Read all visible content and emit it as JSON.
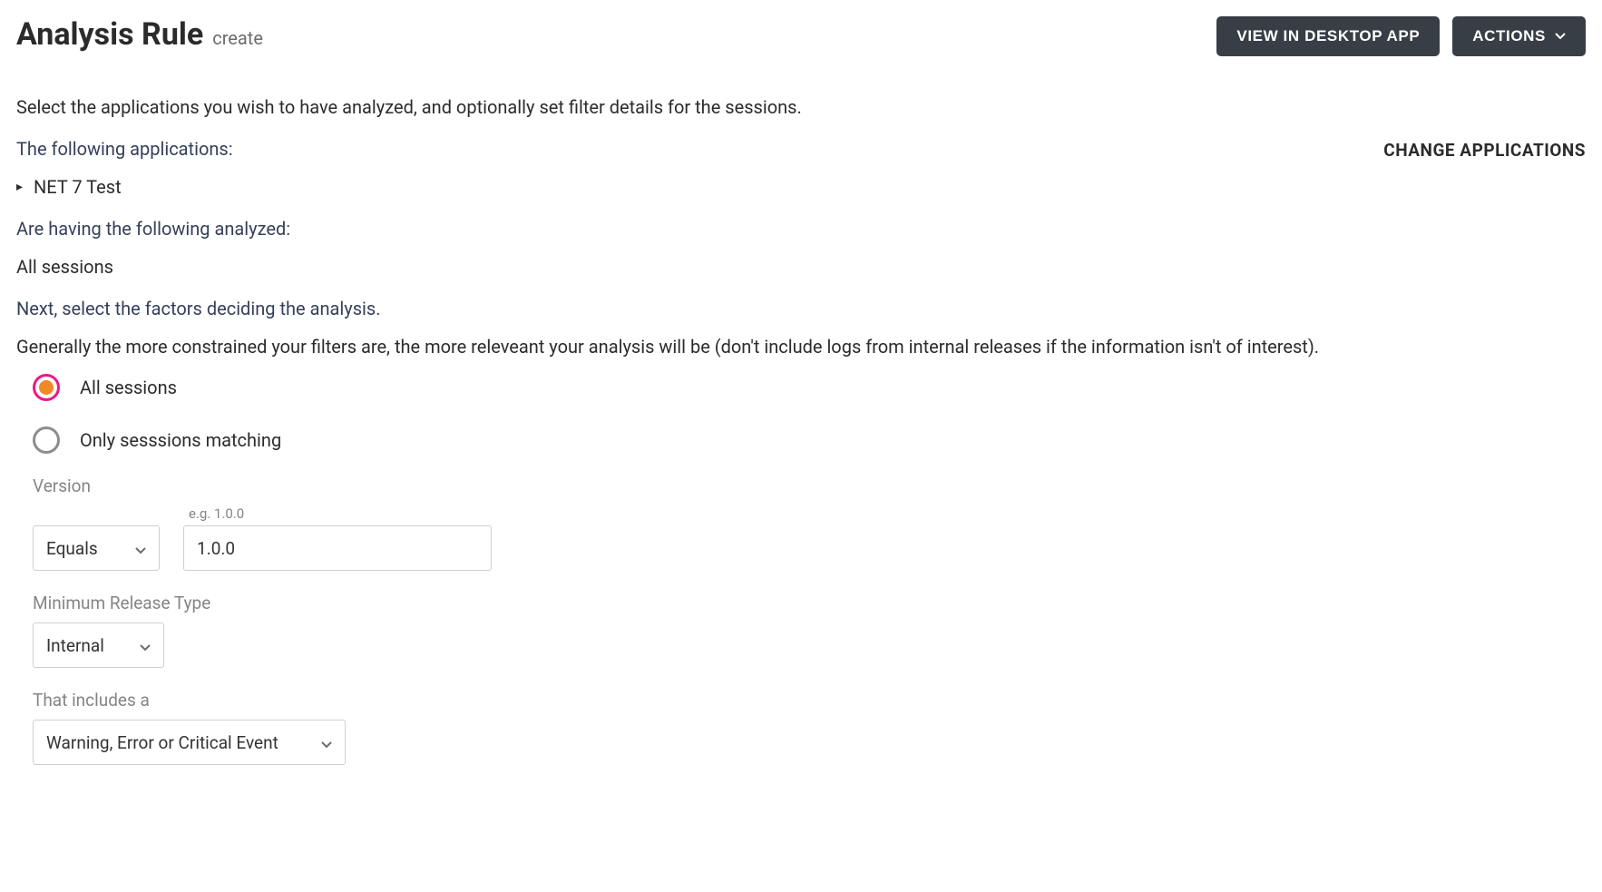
{
  "header": {
    "title": "Analysis Rule",
    "subtitle": "create",
    "view_button": "VIEW IN DESKTOP APP",
    "actions_button": "ACTIONS"
  },
  "intro": "Select the applications you wish to have analyzed, and optionally set filter details for the sessions.",
  "applications": {
    "heading": "The following applications:",
    "change_label": "CHANGE APPLICATIONS",
    "items": [
      "NET 7 Test"
    ]
  },
  "analyzed": {
    "heading": "Are having the following analyzed:",
    "value": "All sessions"
  },
  "factors_heading": "Next, select the factors deciding the analysis.",
  "factors_help": "Generally the more constrained your filters are, the more releveant your analysis will be (don't include logs from internal releases if the information isn't of interest).",
  "radio": {
    "all": "All sessions",
    "matching": "Only sesssions matching",
    "selected": "all"
  },
  "filters": {
    "version": {
      "label": "Version",
      "operator": "Equals",
      "placeholder": "e.g. 1.0.0",
      "value": "1.0.0"
    },
    "min_release": {
      "label": "Minimum Release Type",
      "value": "Internal"
    },
    "includes": {
      "label": "That includes a",
      "value": "Warning, Error or Critical Event"
    }
  }
}
